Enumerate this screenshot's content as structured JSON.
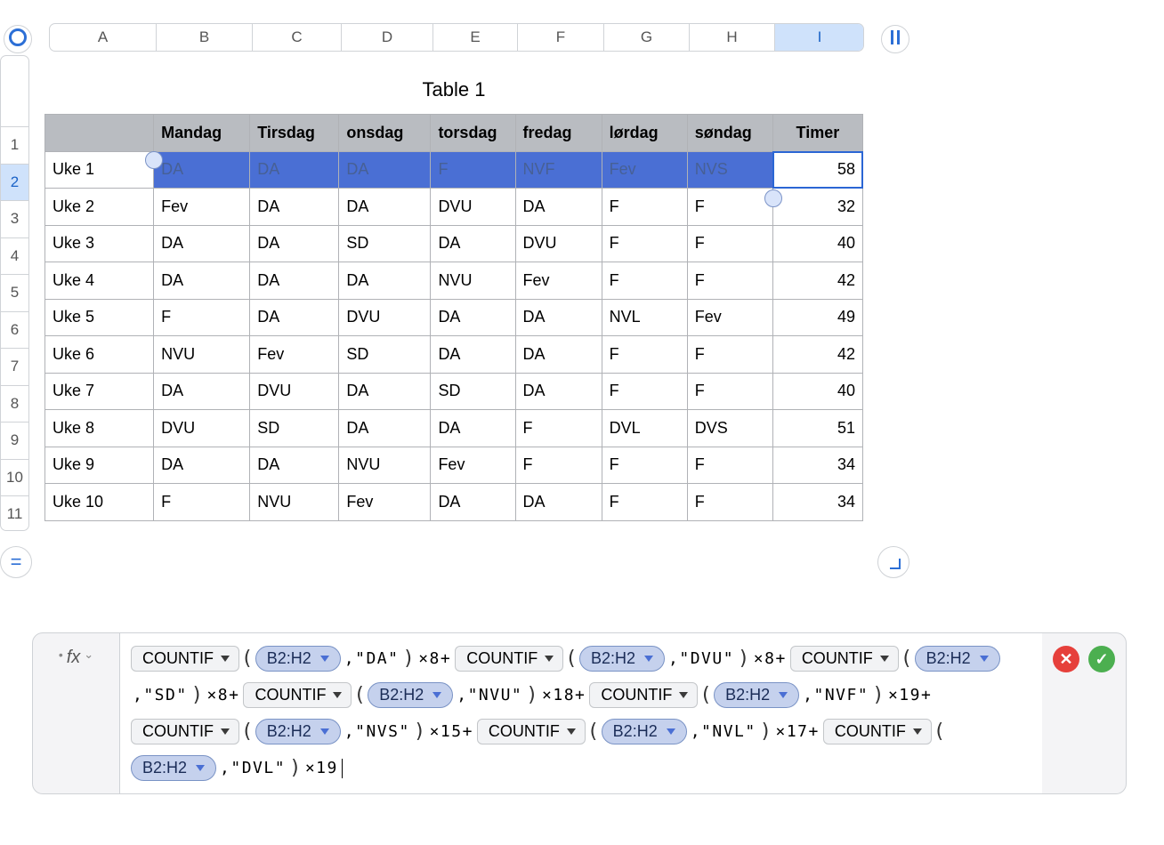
{
  "columns": [
    "A",
    "B",
    "C",
    "D",
    "E",
    "F",
    "G",
    "H",
    "I"
  ],
  "rowNumbers": [
    "1",
    "2",
    "3",
    "4",
    "5",
    "6",
    "7",
    "8",
    "9",
    "10",
    "11"
  ],
  "selectedColIndex": 8,
  "selectedRowIndex": 1,
  "table": {
    "title": "Table 1",
    "headers": [
      "",
      "Mandag",
      "Tirsdag",
      "onsdag",
      "torsdag",
      "fredag",
      "lørdag",
      "søndag",
      "Timer"
    ],
    "rows": [
      {
        "label": "Uke 1",
        "cells": [
          "DA",
          "DA",
          "DA",
          "F",
          "NVF",
          "Fev",
          "NVS"
        ],
        "timer": "58"
      },
      {
        "label": "Uke 2",
        "cells": [
          "Fev",
          "DA",
          "DA",
          "DVU",
          "DA",
          "F",
          "F"
        ],
        "timer": "32"
      },
      {
        "label": "Uke 3",
        "cells": [
          "DA",
          "DA",
          "SD",
          "DA",
          "DVU",
          "F",
          "F"
        ],
        "timer": "40"
      },
      {
        "label": "Uke 4",
        "cells": [
          "DA",
          "DA",
          "DA",
          "NVU",
          "Fev",
          "F",
          "F"
        ],
        "timer": "42"
      },
      {
        "label": "Uke 5",
        "cells": [
          "F",
          "DA",
          "DVU",
          "DA",
          "DA",
          "NVL",
          "Fev"
        ],
        "timer": "49"
      },
      {
        "label": "Uke 6",
        "cells": [
          "NVU",
          "Fev",
          "SD",
          "DA",
          "DA",
          "F",
          "F"
        ],
        "timer": "42"
      },
      {
        "label": "Uke 7",
        "cells": [
          "DA",
          "DVU",
          "DA",
          "SD",
          "DA",
          "F",
          "F"
        ],
        "timer": "40"
      },
      {
        "label": "Uke 8",
        "cells": [
          "DVU",
          "SD",
          "DA",
          "DA",
          "F",
          "DVL",
          "DVS"
        ],
        "timer": "51"
      },
      {
        "label": "Uke 9",
        "cells": [
          "DA",
          "DA",
          "NVU",
          "Fev",
          "F",
          "F",
          "F"
        ],
        "timer": "34"
      },
      {
        "label": "Uke 10",
        "cells": [
          "F",
          "NVU",
          "Fev",
          "DA",
          "DA",
          "F",
          "F"
        ],
        "timer": "34"
      }
    ]
  },
  "formula": {
    "fxLabel": "fx",
    "range": "B2:H2",
    "func": "COUNTIF",
    "terms": [
      {
        "crit": "\"DA\"",
        "mult": "×8"
      },
      {
        "crit": "\"DVU\"",
        "mult": "×8"
      },
      {
        "crit": "\"SD\"",
        "mult": "×8"
      },
      {
        "crit": "\"NVU\"",
        "mult": "×18"
      },
      {
        "crit": "\"NVF\"",
        "mult": "×19"
      },
      {
        "crit": "\"NVS\"",
        "mult": "×15"
      },
      {
        "crit": "\"NVL\"",
        "mult": "×17"
      },
      {
        "crit": "\"DVL\"",
        "mult": "×19"
      }
    ]
  }
}
